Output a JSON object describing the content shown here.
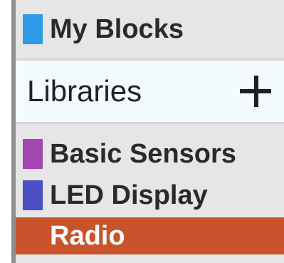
{
  "my_blocks": {
    "label": "My Blocks",
    "color": "#2f9ae6"
  },
  "libraries": {
    "label": "Libraries",
    "add_icon": "plus-icon"
  },
  "library_items": [
    {
      "label": "Basic Sensors",
      "color": "#a246b0",
      "selected": false
    },
    {
      "label": "LED Display",
      "color": "#4b4fc4",
      "selected": false
    },
    {
      "label": "Radio",
      "color": "#c9532b",
      "selected": true
    }
  ],
  "colors": {
    "panel_bg": "#e6e6e6",
    "libraries_bg": "#f3fbff",
    "selected_bg": "#c9532b",
    "left_border": "#8f8f8f"
  }
}
